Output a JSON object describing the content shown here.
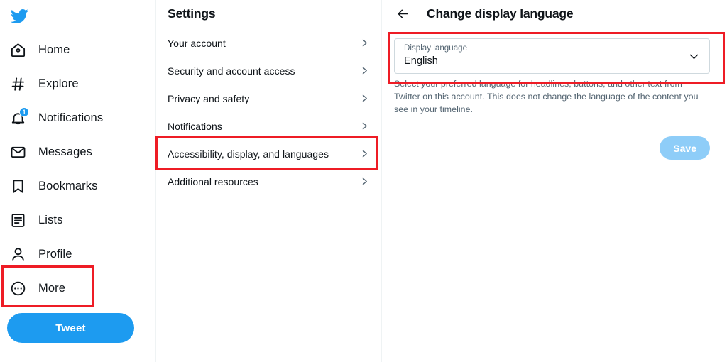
{
  "sidebar": {
    "logo_icon": "twitter-bird-icon",
    "items": [
      {
        "label": "Home",
        "icon": "home-icon",
        "badge": null
      },
      {
        "label": "Explore",
        "icon": "hashtag-icon",
        "badge": null
      },
      {
        "label": "Notifications",
        "icon": "bell-icon",
        "badge": "1"
      },
      {
        "label": "Messages",
        "icon": "envelope-icon",
        "badge": null
      },
      {
        "label": "Bookmarks",
        "icon": "bookmark-icon",
        "badge": null
      },
      {
        "label": "Lists",
        "icon": "list-icon",
        "badge": null
      },
      {
        "label": "Profile",
        "icon": "person-icon",
        "badge": null
      },
      {
        "label": "More",
        "icon": "more-circle-icon",
        "badge": null
      }
    ],
    "tweet_button": "Tweet"
  },
  "settings": {
    "title": "Settings",
    "rows": [
      {
        "label": "Your account"
      },
      {
        "label": "Security and account access"
      },
      {
        "label": "Privacy and safety"
      },
      {
        "label": "Notifications"
      },
      {
        "label": "Accessibility, display, and languages"
      },
      {
        "label": "Additional resources"
      }
    ]
  },
  "detail": {
    "back_icon": "back-arrow-icon",
    "title": "Change display language",
    "select": {
      "caption": "Display language",
      "value": "English",
      "chevron_icon": "chevron-down-icon"
    },
    "helper_text": "Select your preferred language for headlines, buttons, and other text from Twitter on this account. This does not change the language of the content you see in your timeline.",
    "save_label": "Save"
  },
  "colors": {
    "brand_blue": "#1d9bf0",
    "text_primary": "#0f1419",
    "text_secondary": "#536471",
    "border": "#eff3f4",
    "highlight_red": "#ee1c25",
    "save_disabled": "#8ecdf8"
  }
}
